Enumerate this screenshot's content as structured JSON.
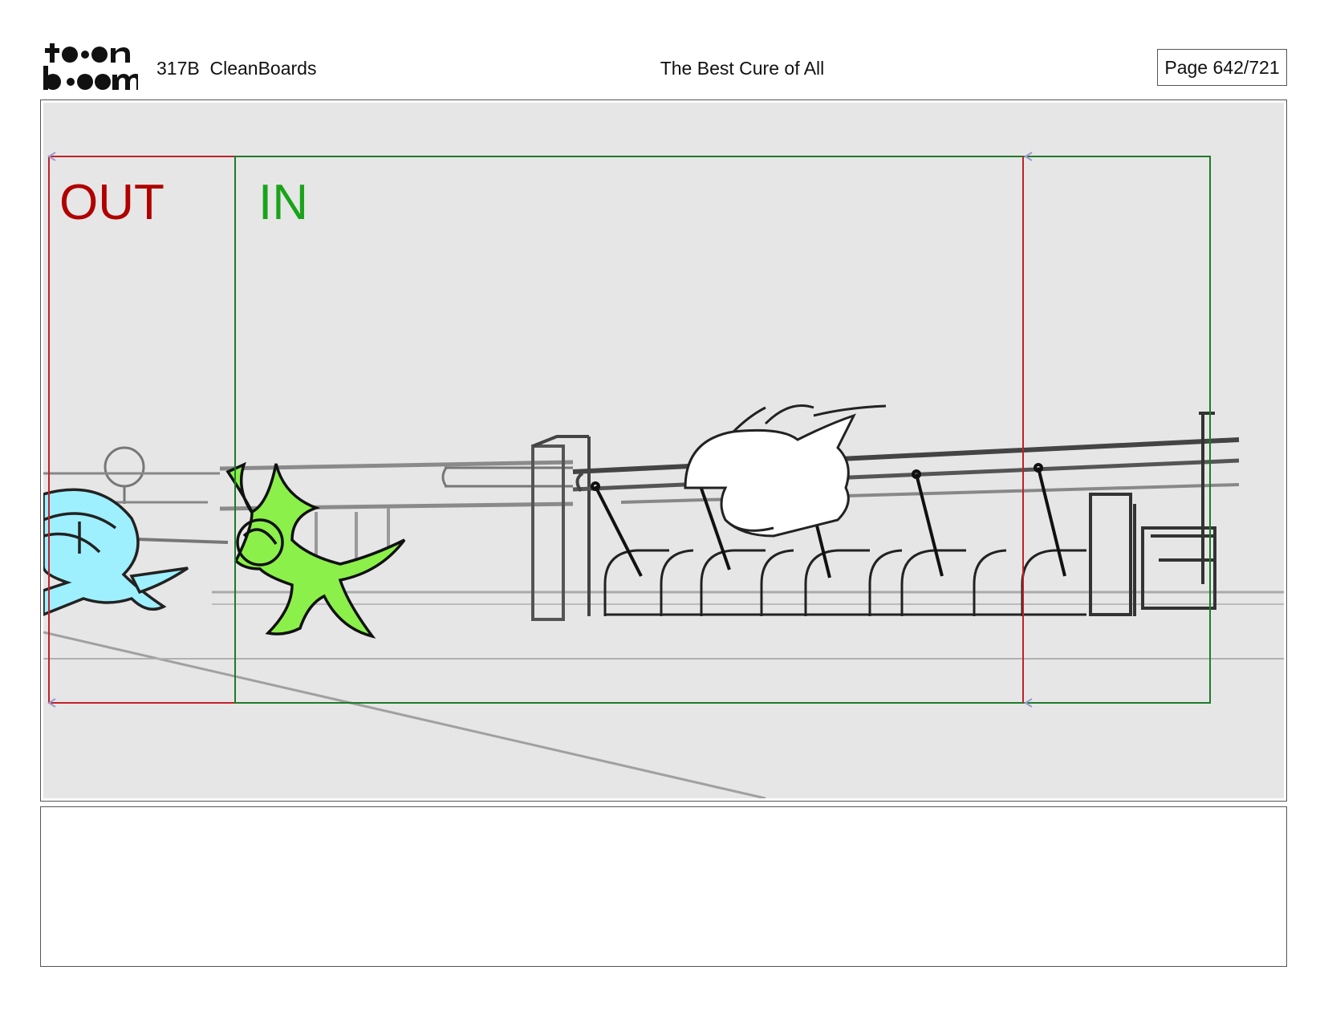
{
  "header": {
    "logo_text_top": "to●n",
    "logo_text_bottom": "b●●m",
    "doc_title": "317B  CleanBoards",
    "episode_title": "The Best Cure of All",
    "page_number": "Page 642/721"
  },
  "panel": {
    "out_label": "OUT",
    "in_label": "IN",
    "colors": {
      "out_frame": "#c0202a",
      "in_frame": "#1e7a2a",
      "background": "#e6e6e6",
      "blue_character": "#9ef0ff",
      "green_character": "#8cf04a"
    }
  },
  "notes": {
    "text": ""
  }
}
